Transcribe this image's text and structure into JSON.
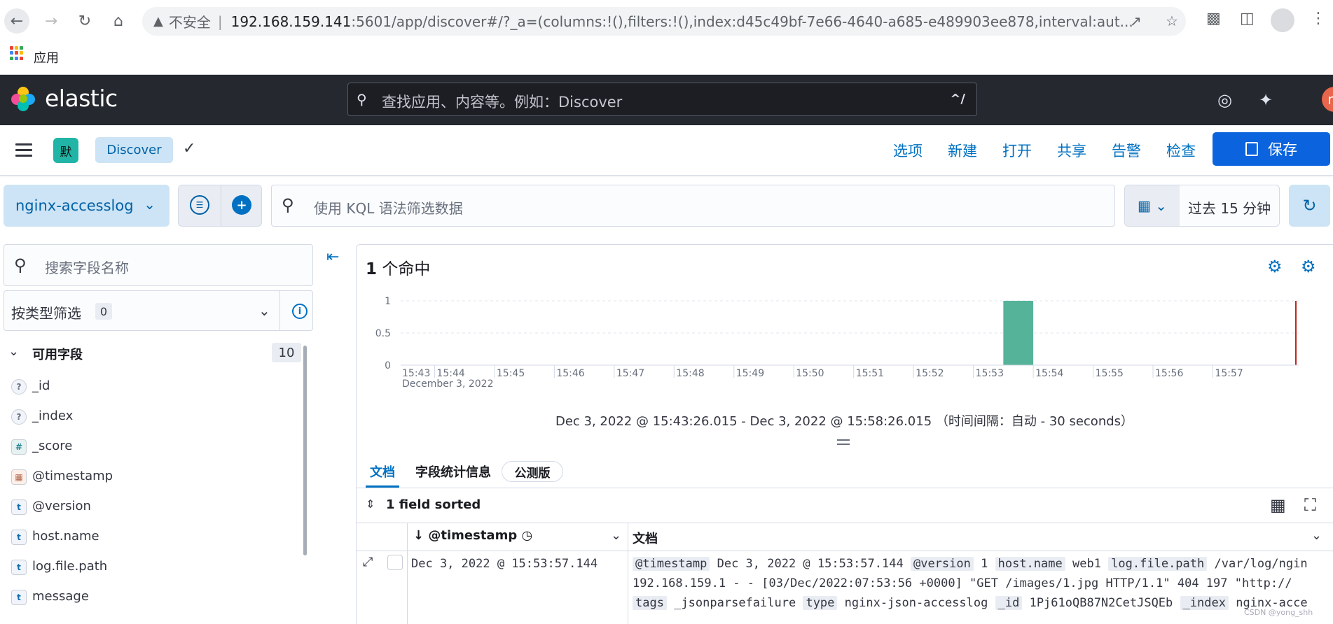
{
  "browser": {
    "insecure_label": "不安全",
    "url_host": "192.168.159.141",
    "url_rest": ":5601/app/discover#/?_a=(columns:!(),filters:!(),index:d45c49bf-7e66-4640-a685-e489903ee878,interval:aut...",
    "bookmark_apps": "应用"
  },
  "header": {
    "brand": "elastic",
    "search_placeholder": "查找应用、内容等。例如：Discover",
    "search_shortcut": "^/",
    "user_initial": "m"
  },
  "appbar": {
    "space_initial": "默",
    "breadcrumb": "Discover",
    "links": [
      "选项",
      "新建",
      "打开",
      "共享",
      "告警",
      "检查"
    ],
    "save_label": "保存"
  },
  "query": {
    "data_view": "nginx-accesslog",
    "kql_placeholder": "使用 KQL 语法筛选数据",
    "time_label": "过去 15 分钟"
  },
  "sidebar": {
    "field_search_placeholder": "搜索字段名称",
    "type_filter_label": "按类型筛选",
    "type_filter_count": "0",
    "available_title": "可用字段",
    "available_count": "10",
    "fields": [
      {
        "name": "_id",
        "type": "?"
      },
      {
        "name": "_index",
        "type": "?"
      },
      {
        "name": "_score",
        "type": "#"
      },
      {
        "name": "@timestamp",
        "type": "date"
      },
      {
        "name": "@version",
        "type": "t"
      },
      {
        "name": "host.name",
        "type": "t"
      },
      {
        "name": "log.file.path",
        "type": "t"
      },
      {
        "name": "message",
        "type": "t"
      }
    ]
  },
  "main": {
    "hits_count": "1",
    "hits_label": "个命中",
    "time_range": "Dec 3, 2022 @ 15:43:26.015 - Dec 3, 2022 @ 15:58:26.015",
    "interval_note": "（时间间隔：自动 - 30 seconds）",
    "tabs": [
      "文档",
      "字段统计信息"
    ],
    "beta": "公测版",
    "sort_label": "1 field sorted",
    "col_timestamp": "@timestamp",
    "col_document": "文档",
    "row": {
      "timestamp": "Dec 3, 2022 @ 15:53:57.144",
      "line1": [
        {
          "k": "@timestamp",
          "v": "Dec 3, 2022 @ 15:53:57.144"
        },
        {
          "k": "@version",
          "v": "1"
        },
        {
          "k": "host.name",
          "v": "web1"
        },
        {
          "k": "log.file.path",
          "v": "/var/log/ngin"
        }
      ],
      "line2": "192.168.159.1 - - [03/Dec/2022:07:53:56 +0000] \"GET /images/1.jpg HTTP/1.1\" 404 197 \"http://",
      "line3": [
        {
          "k": "tags",
          "v": "_jsonparsefailure"
        },
        {
          "k": "type",
          "v": "nginx-json-accesslog"
        },
        {
          "k": "_id",
          "v": "1Pj61oQB87N2CetJSQEb"
        },
        {
          "k": "_index",
          "v": "nginx-acce"
        }
      ]
    },
    "watermark": "CSDN @yong_shh"
  },
  "chart_data": {
    "type": "bar",
    "yticks": [
      "1",
      "0.5",
      "0"
    ],
    "ylim": [
      0,
      1
    ],
    "xticks": [
      "15:43",
      "15:44",
      "15:45",
      "15:46",
      "15:47",
      "15:48",
      "15:49",
      "15:50",
      "15:51",
      "15:52",
      "15:53",
      "15:54",
      "15:55",
      "15:56",
      "15:57"
    ],
    "date_label": "December 3, 2022",
    "bars": [
      {
        "x": "15:53:30",
        "value": 1
      }
    ],
    "colors": {
      "bar": "#54b399",
      "now_marker": "#bd271e"
    }
  }
}
